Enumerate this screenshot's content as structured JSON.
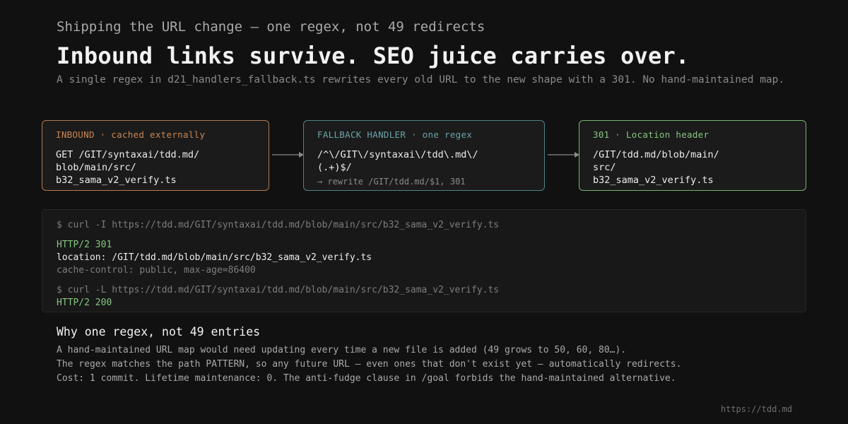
{
  "header": {
    "eyebrow": "Shipping the URL change — one regex, not 49 redirects",
    "headline": "Inbound links survive. SEO juice carries over.",
    "subtitle": "A single regex in d21_handlers_fallback.ts rewrites every old URL to the new shape with a 301. No hand-maintained map."
  },
  "flow": {
    "inbound": {
      "label": "INBOUND · cached externally",
      "lines": [
        "GET /GIT/syntaxai/tdd.md/",
        "blob/main/src/",
        "b32_sama_v2_verify.ts"
      ]
    },
    "fallback": {
      "label": "FALLBACK HANDLER · one regex",
      "lines": [
        "/^\\/GIT\\/syntaxai\\/tdd\\.md\\/",
        "(.+)$/"
      ],
      "note": "→ rewrite /GIT/tdd.md/$1, 301"
    },
    "result": {
      "label": "301 · Location header",
      "lines": [
        "/GIT/tdd.md/blob/main/",
        "src/",
        "b32_sama_v2_verify.ts"
      ]
    }
  },
  "terminal": {
    "cmd1": "$ curl -I https://tdd.md/GIT/syntaxai/tdd.md/blob/main/src/b32_sama_v2_verify.ts",
    "status1": "HTTP/2 301",
    "location": "location: /GIT/tdd.md/blob/main/src/b32_sama_v2_verify.ts",
    "cache": "cache-control: public, max-age=86400",
    "cmd2": "$ curl -L https://tdd.md/GIT/syntaxai/tdd.md/blob/main/src/b32_sama_v2_verify.ts",
    "status2": "HTTP/2 200"
  },
  "why": {
    "title": "Why one regex, not 49 entries",
    "lines": [
      "A hand-maintained URL map would need updating every time a new file is added (49 grows to 50, 60, 80…).",
      "The regex matches the path PATTERN, so any future URL — even ones that don't exist yet — automatically redirects.",
      "Cost: 1 commit. Lifetime maintenance: 0. The anti-fudge clause in /goal forbids the hand-maintained alternative."
    ]
  },
  "footer": {
    "url": "https://tdd.md"
  },
  "colors": {
    "inbound": "#c98654",
    "fallback": "#6aa3a8",
    "result": "#85c57f",
    "background": "#111111"
  }
}
